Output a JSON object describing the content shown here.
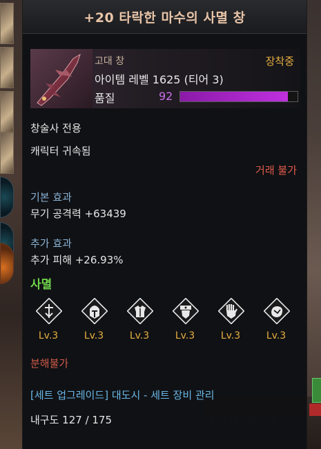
{
  "tooltip": {
    "title": "+20 타락한 마수의 사멸 창",
    "grade": "고대 창",
    "equipped": "장착중",
    "item_level": "아이템 레벨 1625 (티어 3)",
    "quality_label": "품질",
    "quality_value": "92",
    "quality_fraction": 0.92,
    "class_only": "창술사 전용",
    "bound": "캐릭터 귀속됨",
    "trade": "거래 불가",
    "base_effect_title": "기본 효과",
    "base_effect": "무기 공격력 +63439",
    "extra_effect_title": "추가 효과",
    "extra_effect": "추가 피해 +26.93%",
    "destroy_title": "사멸",
    "engravings": [
      {
        "icon": "sword-crest-icon",
        "level": "Lv.3"
      },
      {
        "icon": "helmet-icon",
        "level": "Lv.3"
      },
      {
        "icon": "armor-icon",
        "level": "Lv.3"
      },
      {
        "icon": "gloves-icon",
        "level": "Lv.3"
      },
      {
        "icon": "hand-icon",
        "level": "Lv.3"
      },
      {
        "icon": "bag-icon",
        "level": "Lv.3"
      }
    ],
    "dismantle": "분해불가",
    "set_link": "[세트 업그레이드] 대도시 - 세트 장비 관리",
    "durability": "내구도 127 / 175"
  },
  "background": {
    "bottom_text": "19576719576"
  },
  "colors": {
    "title": "#e8c4a8",
    "equipped": "#e8b040",
    "quality": "#c870e8",
    "section": "#8ab4d8",
    "trade": "#e05a4a",
    "destroy": "#6fd24a",
    "set_link": "#6ab8e8"
  }
}
